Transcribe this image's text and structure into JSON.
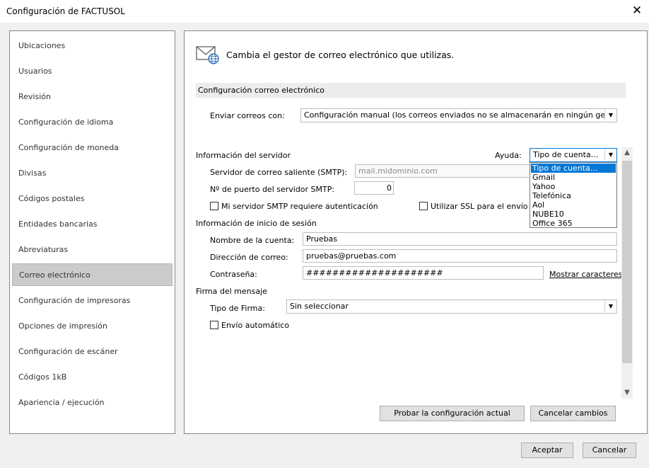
{
  "window": {
    "title": "Configuración de FACTUSOL",
    "close_glyph": "✕"
  },
  "sidebar": {
    "items": [
      {
        "label": "Ubicaciones"
      },
      {
        "label": "Usuarios"
      },
      {
        "label": "Revisión"
      },
      {
        "label": "Configuración de idioma"
      },
      {
        "label": "Configuración de moneda"
      },
      {
        "label": "Divisas"
      },
      {
        "label": "Códigos postales"
      },
      {
        "label": "Entidades bancarias"
      },
      {
        "label": "Abreviaturas"
      },
      {
        "label": "Correo electrónico",
        "selected": true
      },
      {
        "label": "Configuración de impresoras"
      },
      {
        "label": "Opciones de impresión"
      },
      {
        "label": "Configuración de escáner"
      },
      {
        "label": "Códigos 1kB"
      },
      {
        "label": "Apariencia / ejecución"
      }
    ]
  },
  "main": {
    "header": "Cambia el gestor de correo electrónico que utilizas.",
    "header_icon": "mail-globe-icon",
    "section_title": "Configuración correo electrónico",
    "send_with_label": "Enviar correos con:",
    "send_with_value": "Configuración manual (los correos enviados no se almacenarán en ningún gestor de correo)",
    "server_info_title": "Información del servidor",
    "help_label": "Ayuda:",
    "help_combo_value": "Tipo de cuenta...",
    "help_options": [
      "Tipo de cuenta...",
      "Gmail",
      "Yahoo",
      "Telefónica",
      "Aol",
      "NUBE10",
      "Office 365"
    ],
    "smtp_label": "Servidor de correo saliente (SMTP):",
    "smtp_placeholder": "mail.midominio.com",
    "port_label": "Nº de puerto del servidor SMTP:",
    "port_value": "0",
    "auth_checkbox_label": "Mi servidor SMTP requiere autenticación",
    "ssl_checkbox_label": "Utilizar SSL para el envío de",
    "login_title": "Información de inicio de sesión",
    "account_name_label": "Nombre de la cuenta:",
    "account_name_value": "Pruebas",
    "email_label": "Dirección de correo:",
    "email_value": "pruebas@pruebas.com",
    "password_label": "Contraseña:",
    "password_value": "#####################",
    "show_chars_link": "Mostrar caracteres",
    "signature_title": "Firma del mensaje",
    "signature_type_label": "Tipo de Firma:",
    "signature_type_value": "Sin seleccionar",
    "auto_send_label": "Envío automático",
    "test_button": "Probar la configuración actual",
    "cancel_changes_button": "Cancelar cambios"
  },
  "footer": {
    "accept_button": "Aceptar",
    "cancel_button": "Cancelar"
  },
  "colors": {
    "selection": "#0078d7",
    "sidebar_selected": "#cbcbcb"
  }
}
